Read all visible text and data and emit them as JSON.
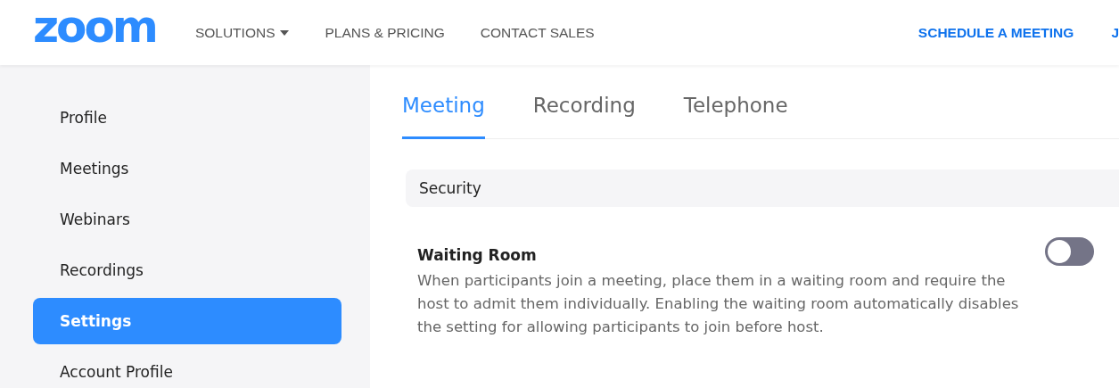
{
  "header": {
    "logo": "zoom",
    "nav": [
      {
        "label": "SOLUTIONS",
        "dropdown": true
      },
      {
        "label": "PLANS & PRICING",
        "dropdown": false
      },
      {
        "label": "CONTACT SALES",
        "dropdown": false
      }
    ],
    "actions": [
      "SCHEDULE A MEETING",
      "J"
    ]
  },
  "sidebar": {
    "items": [
      {
        "label": "Profile",
        "selected": false
      },
      {
        "label": "Meetings",
        "selected": false
      },
      {
        "label": "Webinars",
        "selected": false
      },
      {
        "label": "Recordings",
        "selected": false
      },
      {
        "label": "Settings",
        "selected": true
      },
      {
        "label": "Account Profile",
        "selected": false
      }
    ]
  },
  "tabs": [
    {
      "label": "Meeting",
      "selected": true
    },
    {
      "label": "Recording",
      "selected": false
    },
    {
      "label": "Telephone",
      "selected": false
    }
  ],
  "section": {
    "title": "Security"
  },
  "settings": [
    {
      "title": "Waiting Room",
      "description": "When participants join a meeting, place them in a waiting room and require the host to admit them individually. Enabling the waiting room automatically disables the setting for allowing participants to join before host.",
      "on": false
    }
  ]
}
